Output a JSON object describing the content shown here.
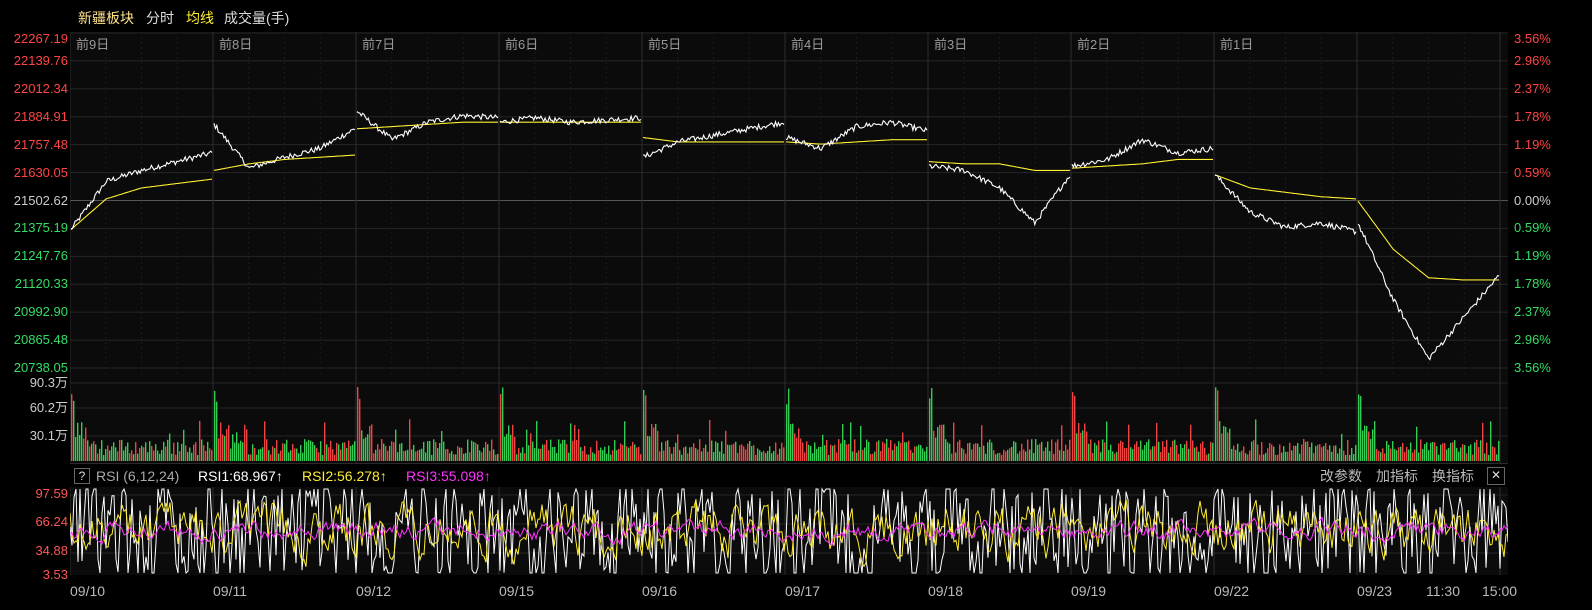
{
  "header": {
    "sector_name": "新疆板块",
    "tab_intraday": "分时",
    "tab_average": "均线",
    "tab_volume": "成交量(手)"
  },
  "price_axis": {
    "left_labels": [
      "22267.19",
      "22139.76",
      "22012.34",
      "21884.91",
      "21757.48",
      "21630.05",
      "21502.62",
      "21375.19",
      "21247.76",
      "21120.33",
      "20992.90",
      "20865.48",
      "20738.05"
    ],
    "right_labels": [
      "3.56%",
      "2.96%",
      "2.37%",
      "1.78%",
      "1.19%",
      "0.59%",
      "0.00%",
      "0.59%",
      "1.19%",
      "1.78%",
      "2.37%",
      "2.96%",
      "3.56%"
    ],
    "colors": {
      "up": "#ff4444",
      "neutral": "#cccccc",
      "down": "#33dd66"
    }
  },
  "day_labels": [
    "前9日",
    "前8日",
    "前7日",
    "前6日",
    "前5日",
    "前4日",
    "前3日",
    "前2日",
    "前1日"
  ],
  "volume_axis": {
    "labels": [
      "90.3万",
      "60.2万",
      "30.1万"
    ]
  },
  "rsi": {
    "help": "?",
    "title": "RSI (6,12,24)",
    "rsi1": "RSI1:68.967↑",
    "rsi2": "RSI2:56.278↑",
    "rsi3": "RSI3:55.098↑",
    "labels": [
      "97.59",
      "66.24",
      "34.88",
      "3.53"
    ],
    "buttons": {
      "params": "改参数",
      "add": "加指标",
      "switch": "换指标",
      "close": "✕"
    }
  },
  "x_axis": [
    "09/10",
    "09/11",
    "09/12",
    "09/15",
    "09/16",
    "09/17",
    "09/18",
    "09/19",
    "09/22",
    "09/23",
    "11:30",
    "15:00"
  ],
  "chart_data": {
    "type": "line",
    "sector": "新疆板块",
    "ylim": [
      20738.05,
      22267.19
    ],
    "baseline": 21502.62,
    "days": [
      "前9日",
      "前8日",
      "前7日",
      "前6日",
      "前5日",
      "前4日",
      "前3日",
      "前2日",
      "前1日",
      "09/23"
    ],
    "series": [
      {
        "name": "分时",
        "color": "#ffffff",
        "values": [
          21370,
          21590,
          21640,
          21680,
          21720,
          21850,
          21650,
          21700,
          21740,
          21830,
          21910,
          21780,
          21860,
          21890,
          21880,
          21860,
          21880,
          21860,
          21870,
          21880,
          21700,
          21770,
          21800,
          21830,
          21860,
          21790,
          21740,
          21840,
          21860,
          21820,
          21660,
          21640,
          21560,
          21400,
          21620,
          21660,
          21690,
          21780,
          21720,
          21740,
          21620,
          21450,
          21380,
          21400,
          21360,
          21400,
          21050,
          20780,
          20970,
          21160
        ]
      },
      {
        "name": "均线",
        "color": "#ffee33",
        "values": [
          21370,
          21510,
          21560,
          21580,
          21600,
          21640,
          21670,
          21690,
          21700,
          21710,
          21830,
          21840,
          21850,
          21860,
          21860,
          21860,
          21860,
          21860,
          21860,
          21860,
          21790,
          21770,
          21770,
          21770,
          21770,
          21770,
          21760,
          21770,
          21780,
          21780,
          21680,
          21670,
          21670,
          21640,
          21640,
          21650,
          21660,
          21670,
          21690,
          21690,
          21620,
          21560,
          21540,
          21520,
          21510,
          21500,
          21280,
          21150,
          21140,
          21140
        ]
      }
    ]
  }
}
